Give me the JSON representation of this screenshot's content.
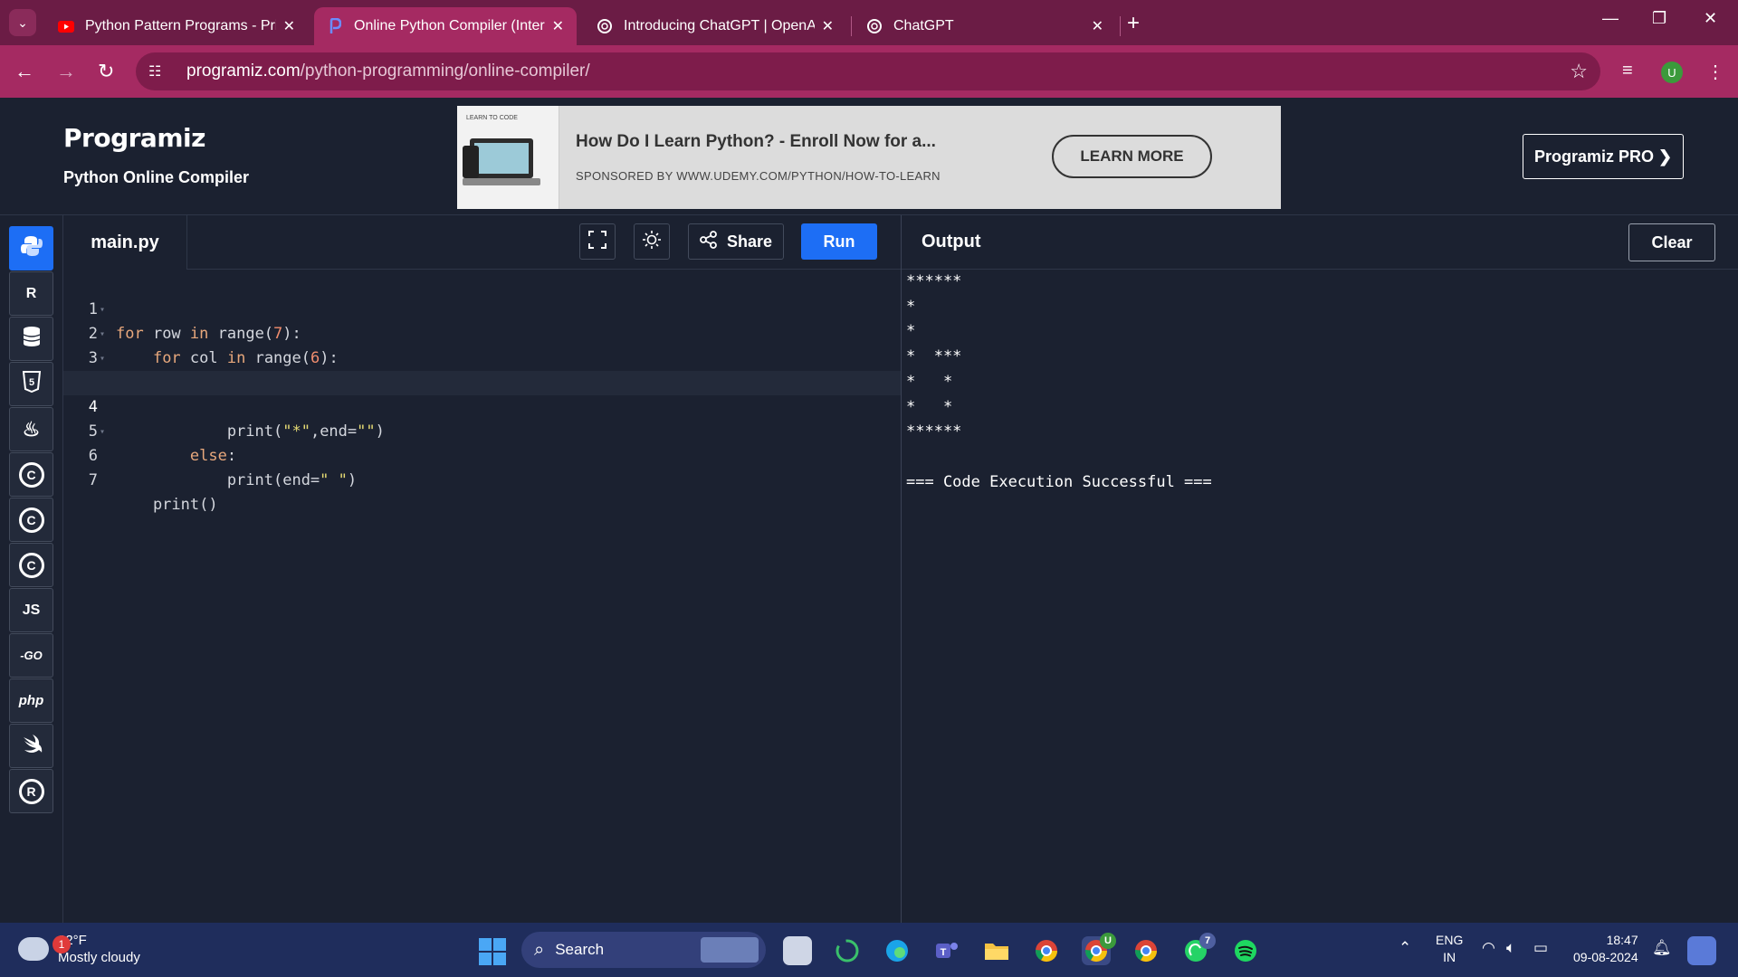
{
  "browser": {
    "tabs": [
      {
        "title": "Python Pattern Programs - Print",
        "favicon": "youtube-icon"
      },
      {
        "title": "Online Python Compiler (Interp",
        "favicon": "programiz-icon"
      },
      {
        "title": "Introducing ChatGPT | OpenAI",
        "favicon": "openai-icon"
      },
      {
        "title": "ChatGPT",
        "favicon": "openai-icon"
      }
    ],
    "url_host": "programiz.com",
    "url_path": "/python-programming/online-compiler/",
    "profile_initial": "U"
  },
  "site": {
    "logo": "Programiz",
    "subtitle": "Python Online Compiler",
    "ad_image_label": "LEARN TO CODE",
    "ad_title": "How Do I Learn Python? - Enroll Now for a...",
    "ad_sponsor": "SPONSORED BY WWW.UDEMY.COM/PYTHON/HOW-TO-LEARN",
    "ad_button": "LEARN MORE",
    "pro_button": "Programiz PRO ❯"
  },
  "languages": [
    {
      "name": "python-icon",
      "label": ""
    },
    {
      "name": "r-icon",
      "label": "R"
    },
    {
      "name": "database-icon",
      "label": ""
    },
    {
      "name": "html5-icon",
      "label": "5"
    },
    {
      "name": "java-icon",
      "label": "♨"
    },
    {
      "name": "c-icon",
      "label": "C"
    },
    {
      "name": "csharp-icon",
      "label": "C"
    },
    {
      "name": "cpp-icon",
      "label": "C"
    },
    {
      "name": "javascript-icon",
      "label": "JS"
    },
    {
      "name": "go-icon",
      "label": "-GO"
    },
    {
      "name": "php-icon",
      "label": "php"
    },
    {
      "name": "swift-icon",
      "label": ""
    },
    {
      "name": "rust-icon",
      "label": "R"
    }
  ],
  "editor": {
    "filename": "main.py",
    "share_label": "Share",
    "run_label": "Run",
    "line_numbers": [
      "1",
      "2",
      "3",
      "",
      "4",
      "5",
      "6",
      "7"
    ]
  },
  "output": {
    "title": "Output",
    "clear_label": "Clear",
    "text": "******\n*\n*\n*  ***\n*   *\n*   *\n******\n\n=== Code Execution Successful ==="
  },
  "taskbar": {
    "weather_temp": "82°F",
    "weather_desc": "Mostly cloudy",
    "weather_badge": "1",
    "search_placeholder": "Search",
    "lang_top": "ENG",
    "lang_bottom": "IN",
    "time": "18:47",
    "date": "09-08-2024",
    "chrome_badge": "U",
    "whatsapp_badge": "7"
  },
  "colors": {
    "tabbar": "#6b1c45",
    "addressbar": "#a52a62",
    "page_bg": "#1b2130",
    "run_button": "#1d6ef5",
    "taskbar": "#1f2d5c"
  }
}
